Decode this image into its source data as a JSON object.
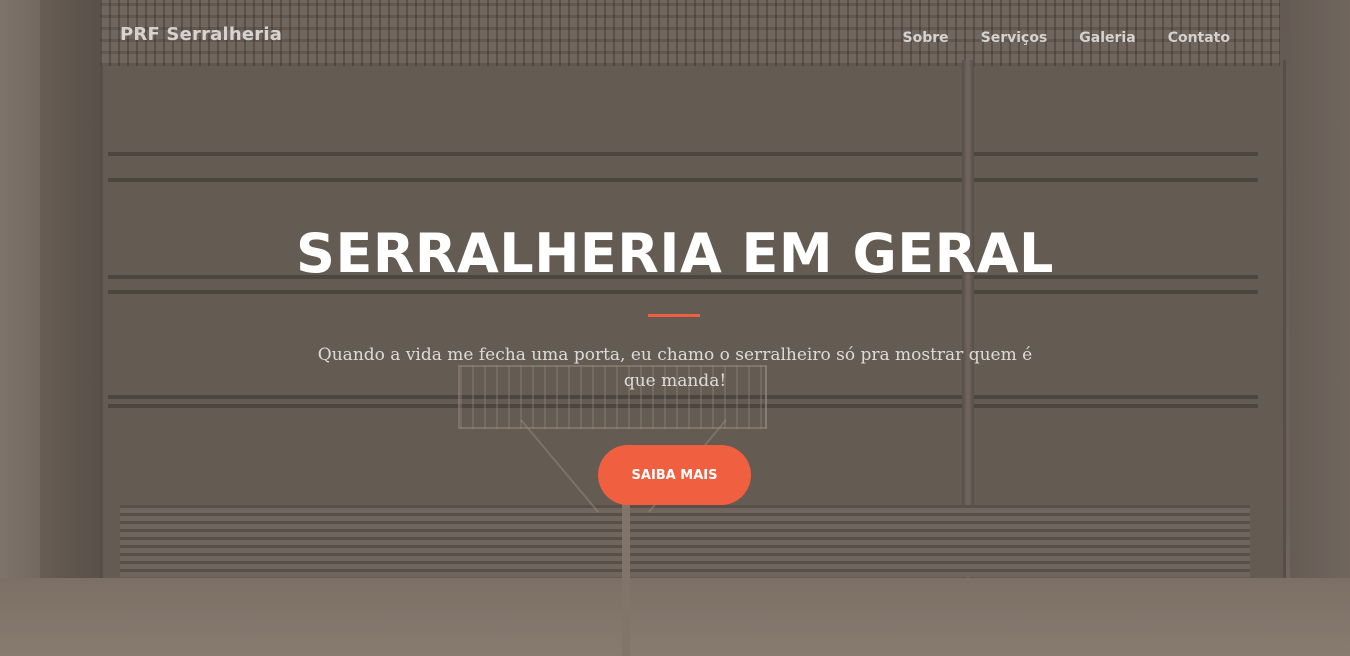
{
  "navbar": {
    "brand": "PRF Serralheria",
    "links": [
      {
        "label": "Sobre"
      },
      {
        "label": "Serviços"
      },
      {
        "label": "Galeria"
      },
      {
        "label": "Contato"
      }
    ]
  },
  "hero": {
    "title": "SERRALHERIA EM GERAL",
    "subtitle": "Quando a vida me fecha uma porta, eu chamo o serralheiro só pra mostrar quem é que manda!",
    "cta_label": "SAIBA MAIS",
    "background_image": "metal-gate-photo"
  },
  "colors": {
    "accent": "#f05f40",
    "text_light": "#ffffff"
  }
}
